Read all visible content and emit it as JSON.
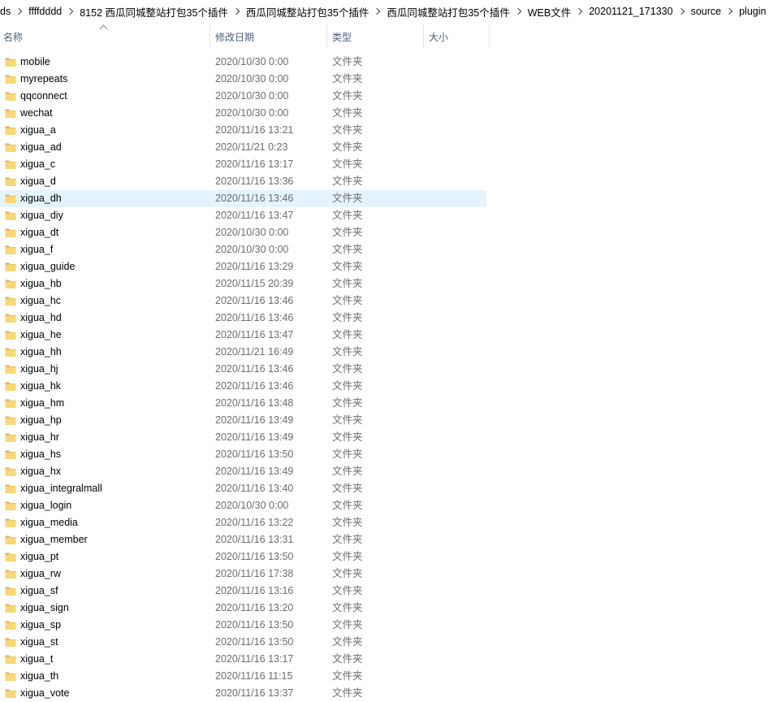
{
  "breadcrumb": [
    "ds",
    "ffffdddd",
    "8152 西瓜同城整站打包35个插件",
    "西瓜同城整站打包35个插件",
    "西瓜同城整站打包35个插件",
    "WEB文件",
    "20201121_171330",
    "source",
    "plugin"
  ],
  "columns": {
    "name": "名称",
    "date": "修改日期",
    "type": "类型",
    "size": "大小"
  },
  "colors": {
    "hover": "#e5f3ff",
    "folder": "#f8d775",
    "folder_dark": "#e0b04a"
  },
  "hover_index": 8,
  "files": [
    {
      "name": "mobile",
      "date": "2020/10/30 0:00",
      "type": "文件夹"
    },
    {
      "name": "myrepeats",
      "date": "2020/10/30 0:00",
      "type": "文件夹"
    },
    {
      "name": "qqconnect",
      "date": "2020/10/30 0:00",
      "type": "文件夹"
    },
    {
      "name": "wechat",
      "date": "2020/10/30 0:00",
      "type": "文件夹"
    },
    {
      "name": "xigua_a",
      "date": "2020/11/16 13:21",
      "type": "文件夹"
    },
    {
      "name": "xigua_ad",
      "date": "2020/11/21 0:23",
      "type": "文件夹"
    },
    {
      "name": "xigua_c",
      "date": "2020/11/16 13:17",
      "type": "文件夹"
    },
    {
      "name": "xigua_d",
      "date": "2020/11/16 13:36",
      "type": "文件夹"
    },
    {
      "name": "xigua_dh",
      "date": "2020/11/16 13:46",
      "type": "文件夹"
    },
    {
      "name": "xigua_diy",
      "date": "2020/11/16 13:47",
      "type": "文件夹"
    },
    {
      "name": "xigua_dt",
      "date": "2020/10/30 0:00",
      "type": "文件夹"
    },
    {
      "name": "xigua_f",
      "date": "2020/10/30 0:00",
      "type": "文件夹"
    },
    {
      "name": "xigua_guide",
      "date": "2020/11/16 13:29",
      "type": "文件夹"
    },
    {
      "name": "xigua_hb",
      "date": "2020/11/15 20:39",
      "type": "文件夹"
    },
    {
      "name": "xigua_hc",
      "date": "2020/11/16 13:46",
      "type": "文件夹"
    },
    {
      "name": "xigua_hd",
      "date": "2020/11/16 13:46",
      "type": "文件夹"
    },
    {
      "name": "xigua_he",
      "date": "2020/11/16 13:47",
      "type": "文件夹"
    },
    {
      "name": "xigua_hh",
      "date": "2020/11/21 16:49",
      "type": "文件夹"
    },
    {
      "name": "xigua_hj",
      "date": "2020/11/16 13:46",
      "type": "文件夹"
    },
    {
      "name": "xigua_hk",
      "date": "2020/11/16 13:46",
      "type": "文件夹"
    },
    {
      "name": "xigua_hm",
      "date": "2020/11/16 13:48",
      "type": "文件夹"
    },
    {
      "name": "xigua_hp",
      "date": "2020/11/16 13:49",
      "type": "文件夹"
    },
    {
      "name": "xigua_hr",
      "date": "2020/11/16 13:49",
      "type": "文件夹"
    },
    {
      "name": "xigua_hs",
      "date": "2020/11/16 13:50",
      "type": "文件夹"
    },
    {
      "name": "xigua_hx",
      "date": "2020/11/16 13:49",
      "type": "文件夹"
    },
    {
      "name": "xigua_integralmall",
      "date": "2020/11/16 13:40",
      "type": "文件夹"
    },
    {
      "name": "xigua_login",
      "date": "2020/10/30 0:00",
      "type": "文件夹"
    },
    {
      "name": "xigua_media",
      "date": "2020/11/16 13:22",
      "type": "文件夹"
    },
    {
      "name": "xigua_member",
      "date": "2020/11/16 13:31",
      "type": "文件夹"
    },
    {
      "name": "xigua_pt",
      "date": "2020/11/16 13:50",
      "type": "文件夹"
    },
    {
      "name": "xigua_rw",
      "date": "2020/11/16 17:38",
      "type": "文件夹"
    },
    {
      "name": "xigua_sf",
      "date": "2020/11/16 13:16",
      "type": "文件夹"
    },
    {
      "name": "xigua_sign",
      "date": "2020/11/16 13:20",
      "type": "文件夹"
    },
    {
      "name": "xigua_sp",
      "date": "2020/11/16 13:50",
      "type": "文件夹"
    },
    {
      "name": "xigua_st",
      "date": "2020/11/16 13:50",
      "type": "文件夹"
    },
    {
      "name": "xigua_t",
      "date": "2020/11/16 13:17",
      "type": "文件夹"
    },
    {
      "name": "xigua_th",
      "date": "2020/11/16 11:15",
      "type": "文件夹"
    },
    {
      "name": "xigua_vote",
      "date": "2020/11/16 13:37",
      "type": "文件夹"
    }
  ]
}
